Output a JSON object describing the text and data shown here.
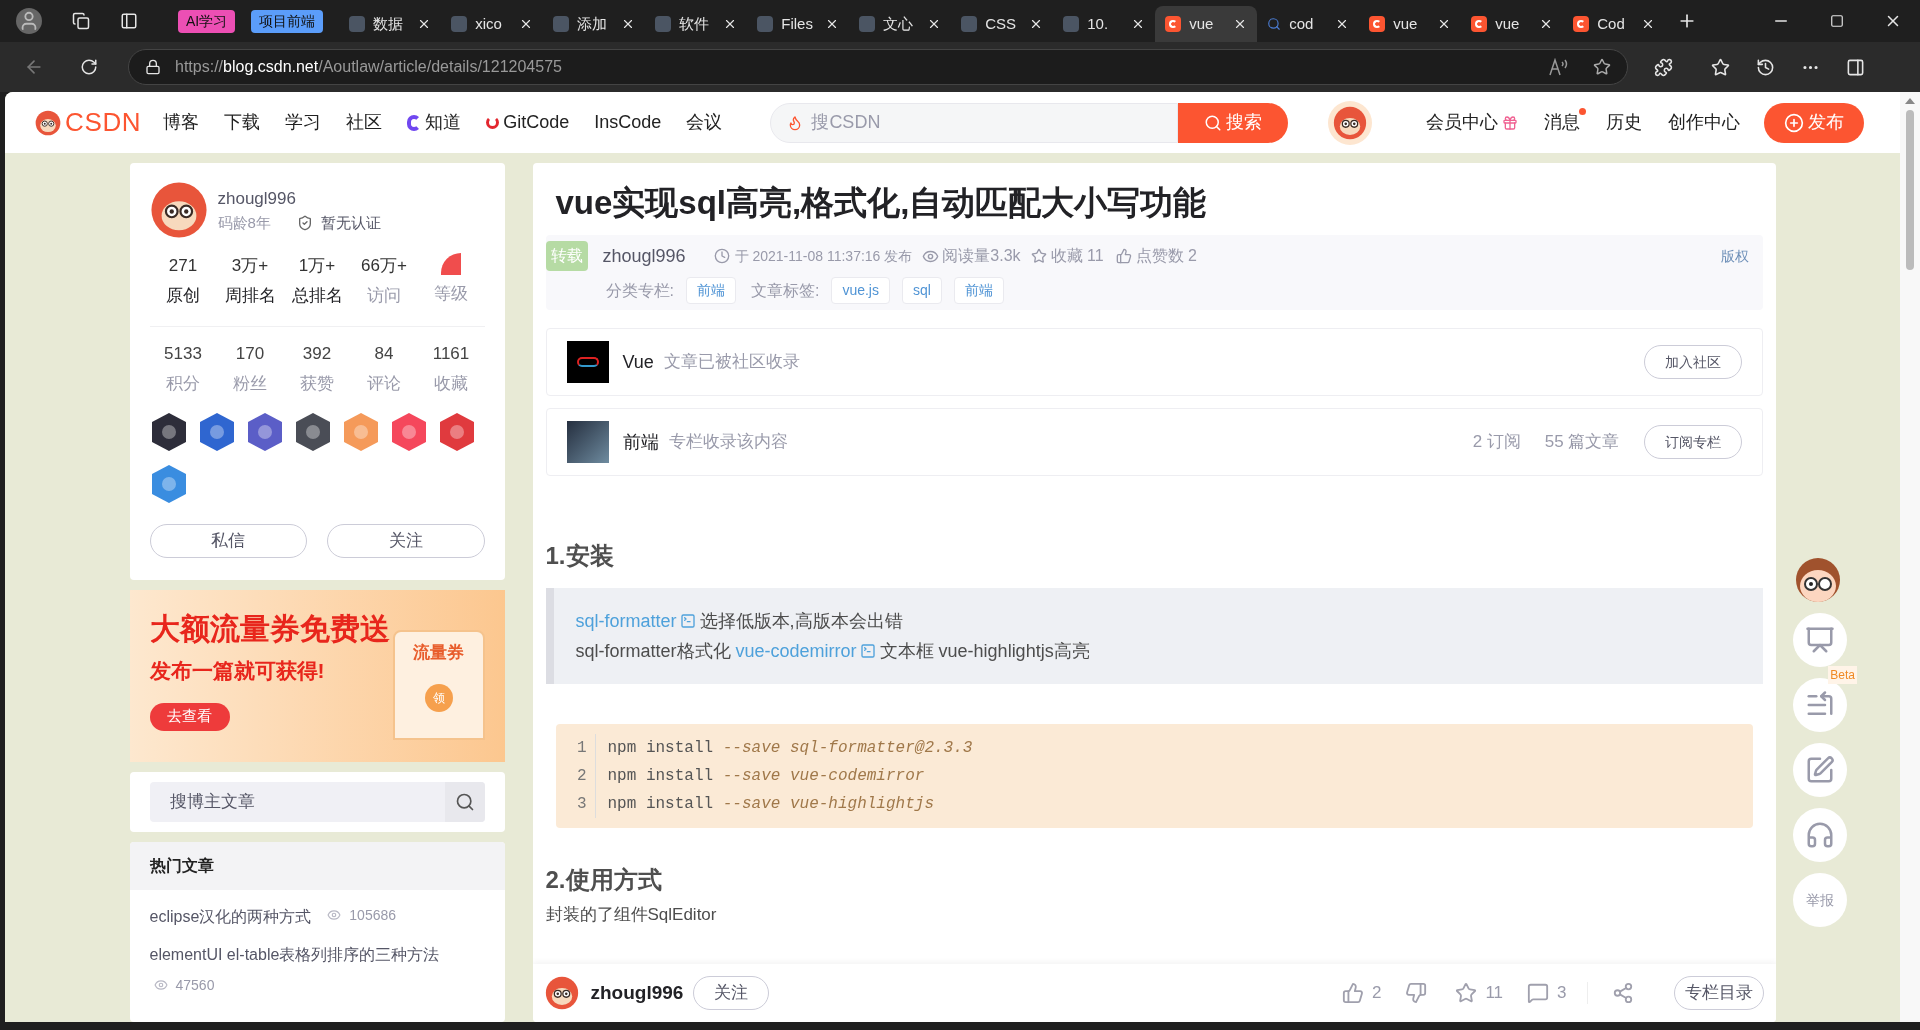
{
  "browser": {
    "tab_groups": [
      {
        "label": "AI学习",
        "color": "#ec4fb4"
      },
      {
        "label": "项目前端",
        "color": "#5b9dfa"
      }
    ],
    "tabs": [
      {
        "title": "数据",
        "kind": "site",
        "selected": false
      },
      {
        "title": "xico",
        "kind": "site",
        "selected": false
      },
      {
        "title": "添加",
        "kind": "site",
        "selected": false
      },
      {
        "title": "软件",
        "kind": "site",
        "selected": false
      },
      {
        "title": "Files",
        "kind": "site",
        "selected": false
      },
      {
        "title": "文心",
        "kind": "site",
        "selected": false
      },
      {
        "title": "CSS",
        "kind": "site",
        "selected": false
      },
      {
        "title": "10.",
        "kind": "site",
        "selected": false
      },
      {
        "title": "vue",
        "kind": "csdn",
        "selected": true
      },
      {
        "title": "cod",
        "kind": "search",
        "selected": false
      },
      {
        "title": "vue",
        "kind": "csdn",
        "selected": false
      },
      {
        "title": "vue",
        "kind": "csdn",
        "selected": false
      },
      {
        "title": "Cod",
        "kind": "csdn",
        "selected": false
      }
    ],
    "url": {
      "scheme": "https://",
      "host": "blog.csdn.net",
      "path": "/Aoutlaw/article/details/121204575"
    }
  },
  "header": {
    "logo": "CSDN",
    "nav": [
      {
        "label": "博客",
        "kind": "text"
      },
      {
        "label": "下载",
        "kind": "text"
      },
      {
        "label": "学习",
        "kind": "text"
      },
      {
        "label": "社区",
        "kind": "text"
      },
      {
        "label": "知道",
        "kind": "zhidao"
      },
      {
        "label": "GitCode",
        "kind": "gitcode"
      },
      {
        "label": "InsCode",
        "kind": "text"
      },
      {
        "label": "会议",
        "kind": "text"
      }
    ],
    "search": {
      "placeholder": "搜CSDN",
      "button": "搜索"
    },
    "links": [
      {
        "label": "会员中心",
        "kind": "gift",
        "dot": false
      },
      {
        "label": "消息",
        "kind": "text",
        "dot": true
      },
      {
        "label": "历史",
        "kind": "text",
        "dot": false
      },
      {
        "label": "创作中心",
        "kind": "text",
        "dot": false
      }
    ],
    "publish": "发布"
  },
  "profile": {
    "name": "zhougl996",
    "age": "码龄8年",
    "cert": "暂无认证",
    "stats_top": [
      {
        "value": "271",
        "label": "原创",
        "muted": false,
        "kind": "text"
      },
      {
        "value": "3万+",
        "label": "周排名",
        "muted": false,
        "kind": "text"
      },
      {
        "value": "1万+",
        "label": "总排名",
        "muted": false,
        "kind": "text"
      },
      {
        "value": "66万+",
        "label": "访问",
        "muted": true,
        "kind": "text"
      },
      {
        "label": "等级",
        "muted": true,
        "kind": "icon"
      }
    ],
    "stats_bottom": [
      {
        "value": "5133",
        "label": "积分"
      },
      {
        "value": "170",
        "label": "粉丝"
      },
      {
        "value": "392",
        "label": "获赞"
      },
      {
        "value": "84",
        "label": "评论"
      },
      {
        "value": "1161",
        "label": "收藏"
      }
    ],
    "buttons": [
      "私信",
      "关注"
    ]
  },
  "banner": {
    "headline": "大额流量券免费送",
    "subline": "发布一篇就可获得!",
    "button": "去查看",
    "coupon": "流量券",
    "seal": "领"
  },
  "blog_search": {
    "placeholder": "搜博主文章"
  },
  "hot_articles": {
    "title": "热门文章",
    "items": [
      {
        "title": "eclipse汉化的两种方式",
        "views": "105686"
      },
      {
        "title": "elementUI el-table表格列排序的三种方法",
        "views": "47560"
      }
    ]
  },
  "article": {
    "title": "vue实现sql高亮,格式化,自动匹配大小写功能",
    "badge": "转载",
    "author": "zhougl996",
    "date": "于 2021-11-08 11:37:16 发布",
    "reads": "阅读量3.3k",
    "favorites": "收藏 11",
    "likes": "点赞数 2",
    "copyright": "版权",
    "category_label": "分类专栏:",
    "categories": [
      "前端"
    ],
    "tags_label": "文章标签:",
    "tags": [
      "vue.js",
      "sql",
      "前端"
    ],
    "community": {
      "name": "Vue",
      "note": "文章已被社区收录",
      "button": "加入社区"
    },
    "column": {
      "name": "前端",
      "note": "专栏收录该内容",
      "subs": "2 订阅",
      "count": "55 篇文章",
      "button": "订阅专栏"
    },
    "section1": "1.安装",
    "note_lines": [
      [
        {
          "kind": "link",
          "text": "sql-formatter"
        },
        {
          "kind": "text",
          "text": "选择低版本,高版本会出错"
        }
      ],
      [
        {
          "kind": "text",
          "text": "sql-formatter格式化 "
        },
        {
          "kind": "link",
          "text": "vue-codemirror"
        },
        {
          "kind": "text",
          "text": "文本框  vue-highlightjs高亮"
        }
      ]
    ],
    "code": [
      {
        "n": "1",
        "cmd": "npm install",
        "flag": "--save",
        "arg": "sql-formatter@2.3.3"
      },
      {
        "n": "2",
        "cmd": "npm install",
        "flag": "--save",
        "arg": "vue-codemirror"
      },
      {
        "n": "3",
        "cmd": "npm install",
        "flag": "--save",
        "arg": "vue-highlightjs"
      }
    ],
    "section2": "2.使用方式",
    "para": "封装的了组件SqlEditor"
  },
  "toolbar": {
    "author": "zhougl996",
    "follow": "关注",
    "likes": "2",
    "favorites": "11",
    "comments": "3",
    "catalog": "专栏目录"
  },
  "side_tools": {
    "beta": "Beta",
    "report": "举报"
  }
}
